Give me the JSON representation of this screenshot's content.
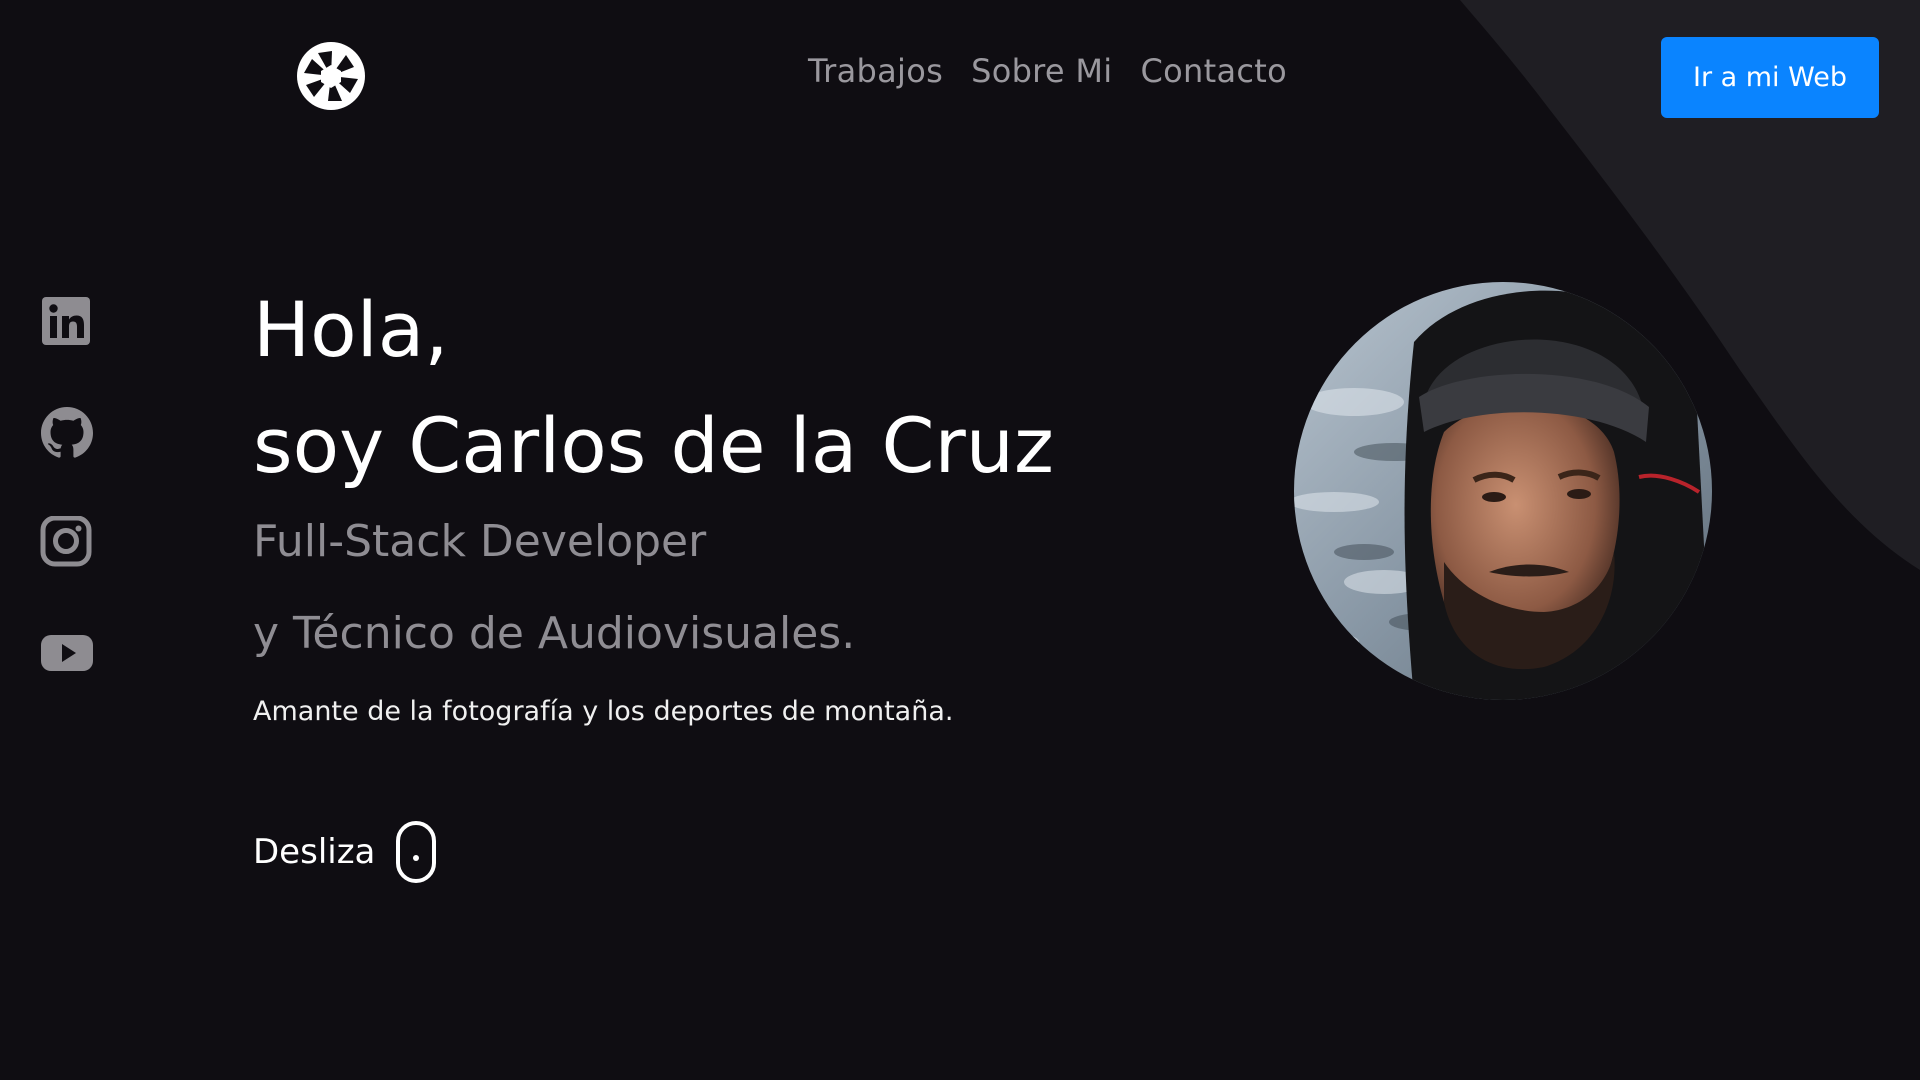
{
  "colors": {
    "background": "#0f0d12",
    "accent": "#0a84ff",
    "nav_text": "#9a989e",
    "muted_text": "#8f8d93",
    "shape": "#1f1e23"
  },
  "header": {
    "logo_icon": "camera-aperture-icon",
    "nav": [
      {
        "label": "Trabajos"
      },
      {
        "label": "Sobre Mi"
      },
      {
        "label": "Contacto"
      }
    ],
    "cta_label": "Ir a mi Web"
  },
  "social": [
    {
      "icon": "linkedin-icon"
    },
    {
      "icon": "github-icon"
    },
    {
      "icon": "instagram-icon"
    },
    {
      "icon": "youtube-icon"
    }
  ],
  "hero": {
    "greeting": "Hola,",
    "name": "soy Carlos de la Cruz",
    "role_line1": "Full-Stack Developer",
    "role_line2": "y Técnico de Audiovisuales.",
    "tagline": "Amante de la fotografía y los deportes de montaña.",
    "scroll_label": "Desliza",
    "scroll_icon": "mouse-icon"
  },
  "avatar": {
    "icon": "profile-photo"
  }
}
